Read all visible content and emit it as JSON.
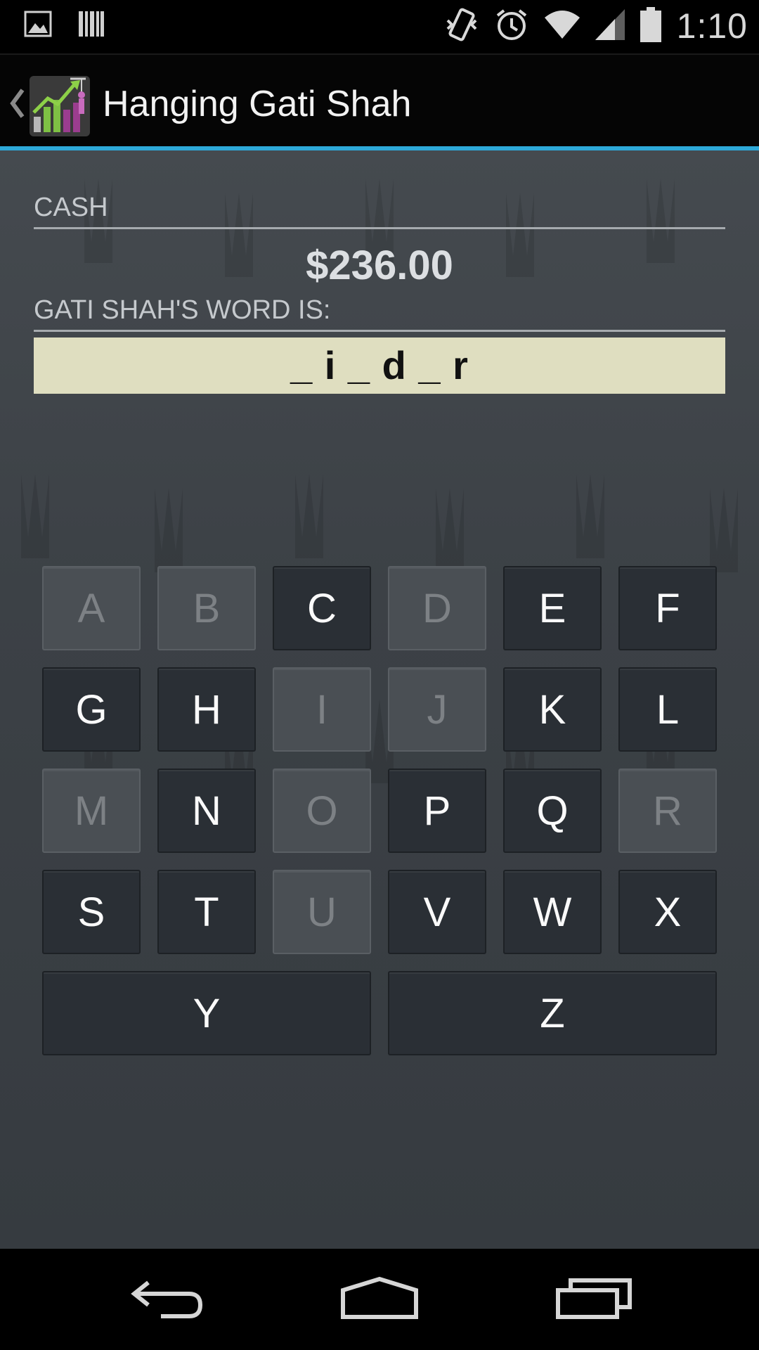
{
  "status_bar": {
    "time": "1:10",
    "icons": [
      "image-icon",
      "barcode-icon",
      "vibrate-icon",
      "alarm-icon",
      "wifi-icon",
      "signal-icon",
      "battery-icon"
    ]
  },
  "action_bar": {
    "title": "Hanging Gati Shah",
    "accent_color": "#2ea9d9"
  },
  "cash": {
    "label": "CASH",
    "value": "$236.00"
  },
  "word": {
    "label": "GATI SHAH'S WORD IS:",
    "display": "_ i _ d _ r",
    "box_color": "#dfdec0"
  },
  "keyboard": {
    "keys": [
      {
        "letter": "A",
        "used": true
      },
      {
        "letter": "B",
        "used": true
      },
      {
        "letter": "C",
        "used": false
      },
      {
        "letter": "D",
        "used": true
      },
      {
        "letter": "E",
        "used": false
      },
      {
        "letter": "F",
        "used": false
      },
      {
        "letter": "G",
        "used": false
      },
      {
        "letter": "H",
        "used": false
      },
      {
        "letter": "I",
        "used": true
      },
      {
        "letter": "J",
        "used": true
      },
      {
        "letter": "K",
        "used": false
      },
      {
        "letter": "L",
        "used": false
      },
      {
        "letter": "M",
        "used": true
      },
      {
        "letter": "N",
        "used": false
      },
      {
        "letter": "O",
        "used": true
      },
      {
        "letter": "P",
        "used": false
      },
      {
        "letter": "Q",
        "used": false
      },
      {
        "letter": "R",
        "used": true
      },
      {
        "letter": "S",
        "used": false
      },
      {
        "letter": "T",
        "used": false
      },
      {
        "letter": "U",
        "used": true
      },
      {
        "letter": "V",
        "used": false
      },
      {
        "letter": "W",
        "used": false
      },
      {
        "letter": "X",
        "used": false
      },
      {
        "letter": "Y",
        "used": false
      },
      {
        "letter": "Z",
        "used": false
      }
    ]
  },
  "nav_bar": {
    "buttons": [
      "back-icon",
      "home-icon",
      "recents-icon"
    ]
  }
}
